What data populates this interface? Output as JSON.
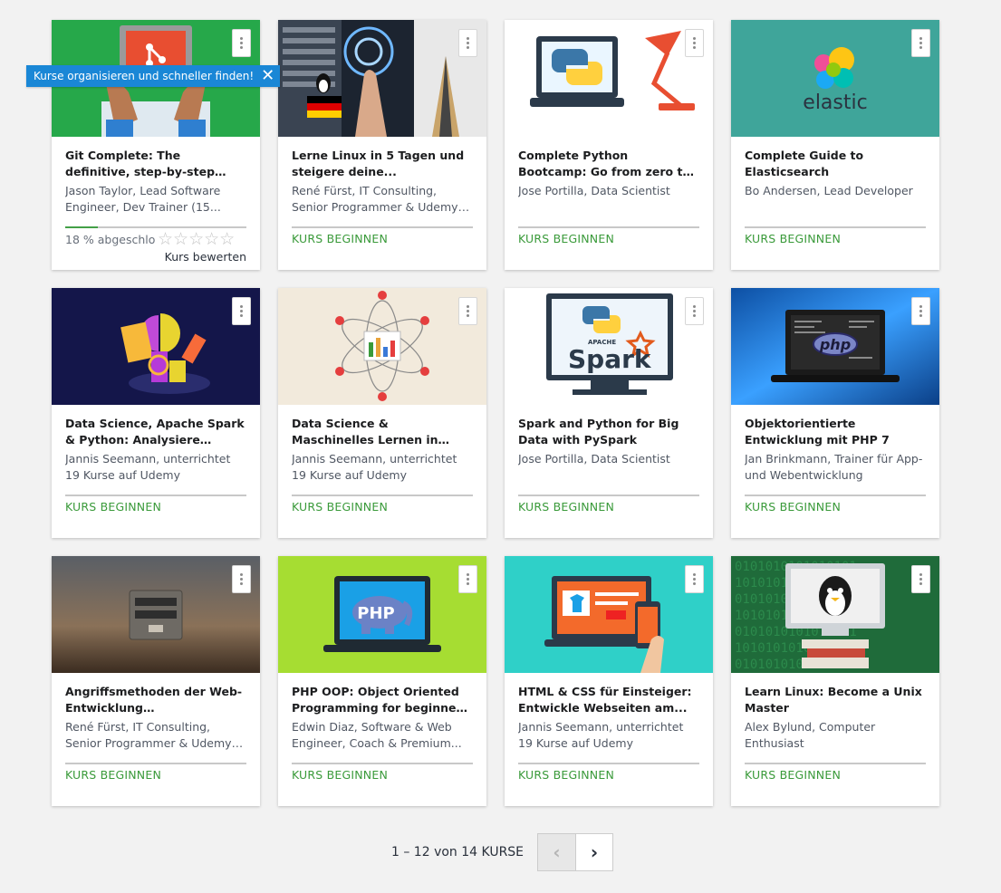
{
  "tooltip": {
    "text": "Kurse organisieren und schneller finden!",
    "close": "✕"
  },
  "courses": [
    {
      "title": "Git Complete: The definitive, step-by-step guide to Git",
      "instructor": "Jason Taylor, Lead Software Engineer, Dev Trainer (15...",
      "progress_text": "18 % abgeschlo...",
      "progress_fraction": 0.18,
      "rating_stars": "☆☆☆☆☆",
      "rate_label": "Kurs bewerten"
    },
    {
      "title": "Lerne Linux in 5 Tagen und steigere deine...",
      "instructor": "René Fürst, IT Consulting, Senior Programmer & Udemy Premiu...",
      "cta": "KURS BEGINNEN"
    },
    {
      "title": "Complete Python Bootcamp: Go from zero to hero in...",
      "instructor": "Jose Portilla, Data Scientist",
      "cta": "KURS BEGINNEN"
    },
    {
      "title": "Complete Guide to Elasticsearch",
      "instructor": "Bo Andersen, Lead Developer",
      "cta": "KURS BEGINNEN",
      "logo_text": "elastic"
    },
    {
      "title": "Data Science, Apache Spark & Python: Analysiere echte...",
      "instructor": "Jannis Seemann, unterrichtet 19 Kurse auf Udemy",
      "cta": "KURS BEGINNEN"
    },
    {
      "title": "Data Science & Maschinelles Lernen in Python - am Beispiel",
      "instructor": "Jannis Seemann, unterrichtet 19 Kurse auf Udemy",
      "cta": "KURS BEGINNEN"
    },
    {
      "title": "Spark and Python for Big Data with PySpark",
      "instructor": "Jose Portilla, Data Scientist",
      "cta": "KURS BEGINNEN",
      "logo_text": "Spark",
      "logo_sub": "APACHE"
    },
    {
      "title": "Objektorientierte Entwicklung mit PHP 7",
      "instructor": "Jan Brinkmann, Trainer für App- und Webentwicklung",
      "cta": "KURS BEGINNEN",
      "logo_text": "php"
    },
    {
      "title": "Angriffsmethoden der Web-Entwicklung kennenlernen...",
      "instructor": "René Fürst, IT Consulting, Senior Programmer & Udemy Premiu...",
      "cta": "KURS BEGINNEN"
    },
    {
      "title": "PHP OOP: Object Oriented Programming for beginners +...",
      "instructor": "Edwin Diaz, Software & Web Engineer, Coach & Premium...",
      "cta": "KURS BEGINNEN",
      "logo_text": "PHP"
    },
    {
      "title": "HTML & CSS für Einsteiger: Entwickle Webseiten am...",
      "instructor": "Jannis Seemann, unterrichtet 19 Kurse auf Udemy",
      "cta": "KURS BEGINNEN"
    },
    {
      "title": "Learn Linux: Become a Unix Master",
      "instructor": "Alex Bylund, Computer Enthusiast",
      "cta": "KURS BEGINNEN"
    }
  ],
  "pagination": {
    "text": "1 – 12 von 14 KURSE",
    "prev": "‹",
    "next": "›"
  },
  "colors": {
    "accent_green": "#3a9a3a",
    "tooltip_blue": "#1a87d6"
  }
}
